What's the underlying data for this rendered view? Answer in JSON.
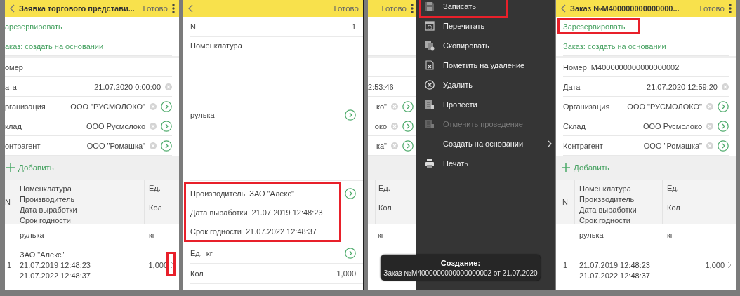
{
  "screens": [
    {
      "kind": "document",
      "cut_left": true,
      "title": "Заявка торгового представи...",
      "done": "Готово",
      "actions": [
        {
          "label": "арезервировать",
          "highlighted": false
        },
        {
          "label": "аказ: создать на основании",
          "highlighted": false
        }
      ],
      "fields": [
        {
          "label": "омер",
          "kind": "right",
          "clear": false,
          "open": false
        },
        {
          "label": "ата",
          "value": "21.07.2020 0:00:00",
          "kind": "right",
          "clear": true,
          "open": false
        },
        {
          "label": "рганизация",
          "value": "ООО \"РУСМОЛОКО\"",
          "kind": "right",
          "clear": true,
          "open": true
        },
        {
          "label": "клад",
          "value": "ООО Русмолоко",
          "kind": "right",
          "clear": true,
          "open": true
        },
        {
          "label": "онтрагент",
          "value": "ООО \"Ромашка\"",
          "kind": "right",
          "clear": true,
          "open": true
        }
      ],
      "add_button": "Добавить",
      "table": {
        "n_header": "N",
        "name_headers": [
          "Номенклатура",
          "Производитель",
          "Дата выработки",
          "Срок годности"
        ],
        "unit_headers": [
          "Ед.",
          "Кол"
        ],
        "rows": [
          {
            "n": "1",
            "item": "рулька",
            "unit": "кг",
            "producer": "ЗАО \"Алекс\"",
            "production_date": "21.07.2019 12:48:23",
            "expiry_date": "21.07.2022 12:48:37",
            "qty": "1,000",
            "highlighted": true
          }
        ]
      }
    },
    {
      "kind": "row_editor",
      "done": "Готово",
      "n_label": "N",
      "n_value": "1",
      "item_label": "Номенклатура",
      "item_value": "рулька",
      "details": [
        {
          "label": "Производитель",
          "value": "ЗАО \"Алекс\"",
          "open": true
        },
        {
          "label": "Дата выработки",
          "value": "21.07.2019 12:48:23",
          "open": false
        },
        {
          "label": "Срок годности",
          "value": "21.07.2022 12:48:37",
          "open": false
        }
      ],
      "details_highlighted": true,
      "unit_label": "Ед.",
      "unit_value": "кг",
      "qty_label": "Кол",
      "qty_value": "1,000"
    },
    {
      "kind": "menu",
      "done": "Готово",
      "fields": [
        {
          "value": "2:53:46",
          "clear": true,
          "open": false
        },
        {
          "value": "ко\"",
          "clear": true,
          "open": true
        },
        {
          "value": "око",
          "clear": true,
          "open": true
        },
        {
          "value": "ка\"",
          "clear": true,
          "open": true
        }
      ],
      "unit_headers": [
        "Ед.",
        "Кол"
      ],
      "unit": "кг",
      "menu": [
        {
          "label": "Записать",
          "highlighted": true,
          "disabled": false,
          "submenu": false
        },
        {
          "label": "Перечитать",
          "highlighted": false,
          "disabled": false,
          "submenu": false
        },
        {
          "label": "Скопировать",
          "highlighted": false,
          "disabled": false,
          "submenu": false
        },
        {
          "label": "Пометить на удаление",
          "highlighted": false,
          "disabled": false,
          "submenu": false
        },
        {
          "label": "Удалить",
          "highlighted": false,
          "disabled": false,
          "submenu": false
        },
        {
          "label": "Провести",
          "highlighted": false,
          "disabled": false,
          "submenu": false
        },
        {
          "label": "Отменить проведение",
          "highlighted": false,
          "disabled": true,
          "submenu": false
        },
        {
          "label": "Создать на основании",
          "highlighted": false,
          "disabled": false,
          "submenu": true
        },
        {
          "label": "Печать",
          "highlighted": false,
          "disabled": false,
          "submenu": false
        }
      ],
      "toast": {
        "title": "Создание:",
        "text": "Заказ №М4000000000000000002 от 21.07.2020"
      }
    },
    {
      "kind": "document",
      "cut_left": false,
      "title": "Заказ №М400000000000000...",
      "done": "Готово",
      "actions": [
        {
          "label": "Зарезервировать",
          "highlighted": true
        },
        {
          "label": "Заказ: создать на основании",
          "highlighted": false
        }
      ],
      "fields": [
        {
          "label": "Номер",
          "value": "М4000000000000000002",
          "kind": "inline",
          "clear": false,
          "open": false
        },
        {
          "label": "Дата",
          "value": "21.07.2020 12:59:20",
          "kind": "right",
          "clear": true,
          "open": false
        },
        {
          "label": "Организация",
          "value": "ООО \"РУСМОЛОКО\"",
          "kind": "right",
          "clear": true,
          "open": true
        },
        {
          "label": "Склад",
          "value": "ООО Русмолоко",
          "kind": "right",
          "clear": true,
          "open": true
        },
        {
          "label": "Контрагент",
          "value": "ООО \"Ромашка\"",
          "kind": "right",
          "clear": true,
          "open": true
        }
      ],
      "add_button": "Добавить",
      "table": {
        "n_header": "N",
        "name_headers": [
          "Номенклатура",
          "Производитель",
          "Дата выработки",
          "Срок годности"
        ],
        "unit_headers": [
          "Ед.",
          "Кол"
        ],
        "rows": [
          {
            "n": "1",
            "item": "рулька",
            "unit": "кг",
            "production_date": "21.07.2019 12:48:23",
            "expiry_date": "21.07.2022 12:48:37",
            "qty": "1,000",
            "highlighted": false
          }
        ]
      }
    }
  ]
}
